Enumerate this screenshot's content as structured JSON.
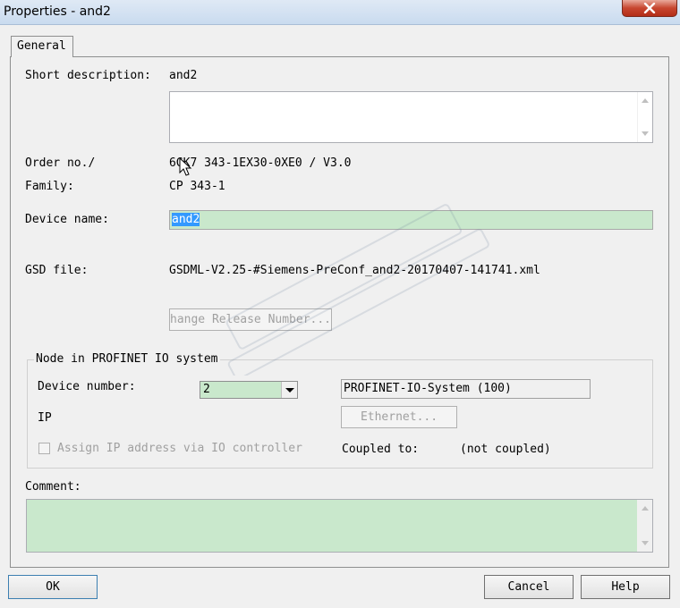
{
  "window": {
    "title": "Properties - and2"
  },
  "tabs": [
    {
      "label": "General"
    }
  ],
  "general": {
    "short_description_label": "Short description:",
    "short_description_value": "and2",
    "order_no_label": "Order no./",
    "order_no_value": "6GK7 343-1EX30-0XE0 / V3.0",
    "family_label": "Family:",
    "family_value": "CP 343-1",
    "device_name_label": "Device name:",
    "device_name_value": "and2",
    "gsd_file_label": "GSD file:",
    "gsd_file_value": "GSDML-V2.25-#Siemens-PreConf_and2-20170407-141741.xml",
    "change_release_button": "hange Release Number..."
  },
  "profinet": {
    "group_title": "Node in PROFINET IO system",
    "device_number_label": "Device number:",
    "device_number_value": "2",
    "io_system_value": "PROFINET-IO-System (100)",
    "ip_label": "IP",
    "ethernet_button": "Ethernet...",
    "assign_ip_label": "Assign IP address via IO controller",
    "coupled_to_label": "Coupled to:",
    "coupled_to_value": "(not coupled)"
  },
  "comment": {
    "label": "Comment:",
    "value": ""
  },
  "footer": {
    "ok": "OK",
    "cancel": "Cancel",
    "help": "Help"
  },
  "colors": {
    "field_green": "#c9e8cc",
    "selection": "#3399ff",
    "close_red": "#c7462f"
  }
}
